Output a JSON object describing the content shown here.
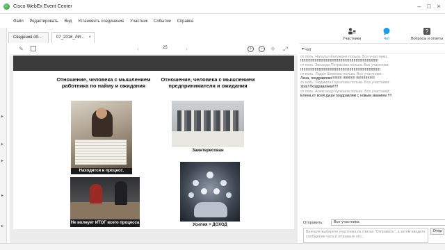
{
  "window": {
    "title": "Cisco WebEx Event Center"
  },
  "menu": [
    "Файл",
    "Редактировать",
    "Вид",
    "Установить соединение",
    "Участник",
    "Событие",
    "Справка"
  ],
  "tabs": [
    {
      "label": "Сведения об..."
    },
    {
      "label": "07_2016_ЛИ..."
    }
  ],
  "doc_toolbar": {
    "page_number": "25"
  },
  "slide": {
    "left_heading": "Отношение, человека с мышлением работника по найму и ожидания",
    "right_heading": "Отношение, человека с мышлением предпринимателя и ожидания",
    "caption_1": "Находятся в процесс.",
    "caption_2": "Не волнует ИТОГ всего процесса",
    "label_interested": "Заинтересован",
    "label_effort": "Усилия = ДОХОД"
  },
  "right_panel": {
    "participants_label": "Участники",
    "chat_label": "Чат",
    "qa_label": "Вопросы и ответы",
    "chat_title": "Чат"
  },
  "chat": [
    {
      "kind": "meta",
      "text": "от поль. Наталья Калужаня полька. Все участники:"
    },
    {
      "kind": "text",
      "text": "!!!!!!!!!!!!!!!!!!!!!!!!!!!!!!!!!!!!!!!!!!!!!!!!!!!!!!!!!!!!!!!!!!!!!!!!!!!!"
    },
    {
      "kind": "meta",
      "text": "от поль. Зинаида Петрасова полька. Все участники:"
    },
    {
      "kind": "text",
      "text": "!!!!!!!!!!!!!!!!!!!!!!!!!!!!!!!!!!!!!!!!!!!!!!!!!!!!!!!!!!!!!!!!!!!!!!!!!!!!!!"
    },
    {
      "kind": "meta",
      "text": "от поль. Лидия Шевкова полька. Все участники:"
    },
    {
      "kind": "text",
      "text": "Лена, поздравляю!!!!!!!!!! !!!!!!!!!!!! !!!!!!!!!!!!!!!!!!"
    },
    {
      "kind": "meta",
      "text": "от поль. Людмила Горгалова полька. Все участники:"
    },
    {
      "kind": "text",
      "text": "Ура!! Поздравляем!!!!!"
    },
    {
      "kind": "meta",
      "text": "от поль. Александр Кулешов полька. Все участники:"
    },
    {
      "kind": "text",
      "text": "Елена,от всей души поздравлям с новым званием !!!!"
    }
  ],
  "send": {
    "label": "Отправить:",
    "selected": "Все участника",
    "placeholder": "Вначале выберите участника из списка \"Отправить\", а затем введите сообщение чата и отправьте его...",
    "button": "Отпр"
  }
}
